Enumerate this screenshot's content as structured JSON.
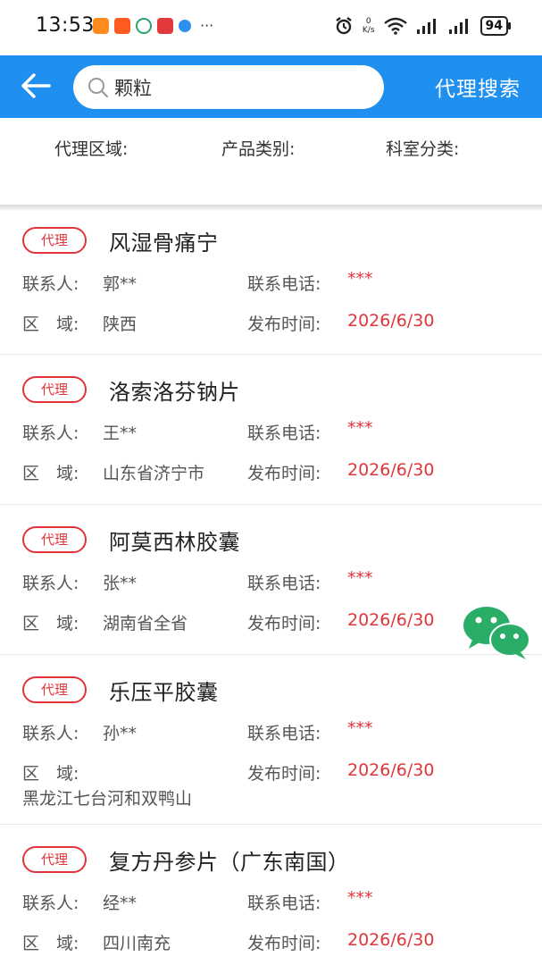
{
  "status_bar": {
    "time": "13:53",
    "more": "···",
    "speed_value": "0",
    "speed_unit": "K/s",
    "battery": "94"
  },
  "header": {
    "back_icon": "arrow-left-icon",
    "search_value": "颗粒",
    "search_action": "代理搜索"
  },
  "filters": [
    {
      "label": "代理区域:"
    },
    {
      "label": "产品类别:"
    },
    {
      "label": "科室分类:"
    }
  ],
  "list_labels": {
    "contact": "联系人:",
    "phone": "联系电话:",
    "region": "区　域:",
    "publish": "发布时间:"
  },
  "items": [
    {
      "badge": "代理",
      "title": "风湿骨痛宁",
      "contact": "郭**",
      "phone": "***",
      "region": "陕西",
      "publish": "2026/6/30"
    },
    {
      "badge": "代理",
      "title": "洛索洛芬钠片",
      "contact": "王**",
      "phone": "***",
      "region": "山东省济宁市",
      "publish": "2026/6/30"
    },
    {
      "badge": "代理",
      "title": "阿莫西林胶囊",
      "contact": "张**",
      "phone": "***",
      "region": "湖南省全省",
      "publish": "2026/6/30"
    },
    {
      "badge": "代理",
      "title": "乐压平胶囊",
      "contact": "孙**",
      "phone": "***",
      "region": "黑龙江七台河和双鸭山",
      "publish": "2026/6/30"
    },
    {
      "badge": "代理",
      "title": "复方丹参片（广东南国）",
      "contact": "经**",
      "phone": "***",
      "region": "四川南充",
      "publish": "2026/6/30"
    }
  ],
  "colors": {
    "header_blue": "#1f8ff0",
    "accent_red": "#e0353a",
    "wechat_green": "#2aae67"
  }
}
